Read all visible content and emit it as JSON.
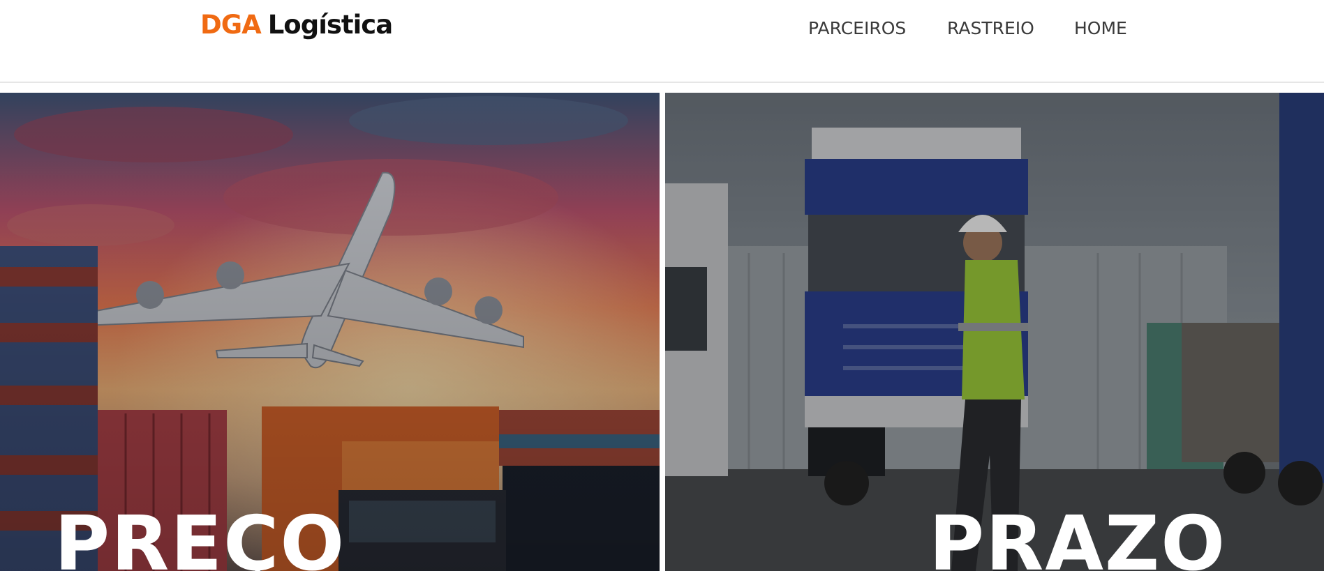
{
  "header": {
    "logo_brand": "DGA",
    "logo_name": "Logística",
    "nav": {
      "parceiros": "PARCEIROS",
      "rastreio": "RASTREIO",
      "home": "HOME"
    }
  },
  "panels": {
    "left": {
      "title": "PREÇO"
    },
    "right": {
      "title": "PRAZO"
    }
  },
  "colors": {
    "brand_orange": "#f06a12",
    "nav_text": "#3a3a3a"
  }
}
